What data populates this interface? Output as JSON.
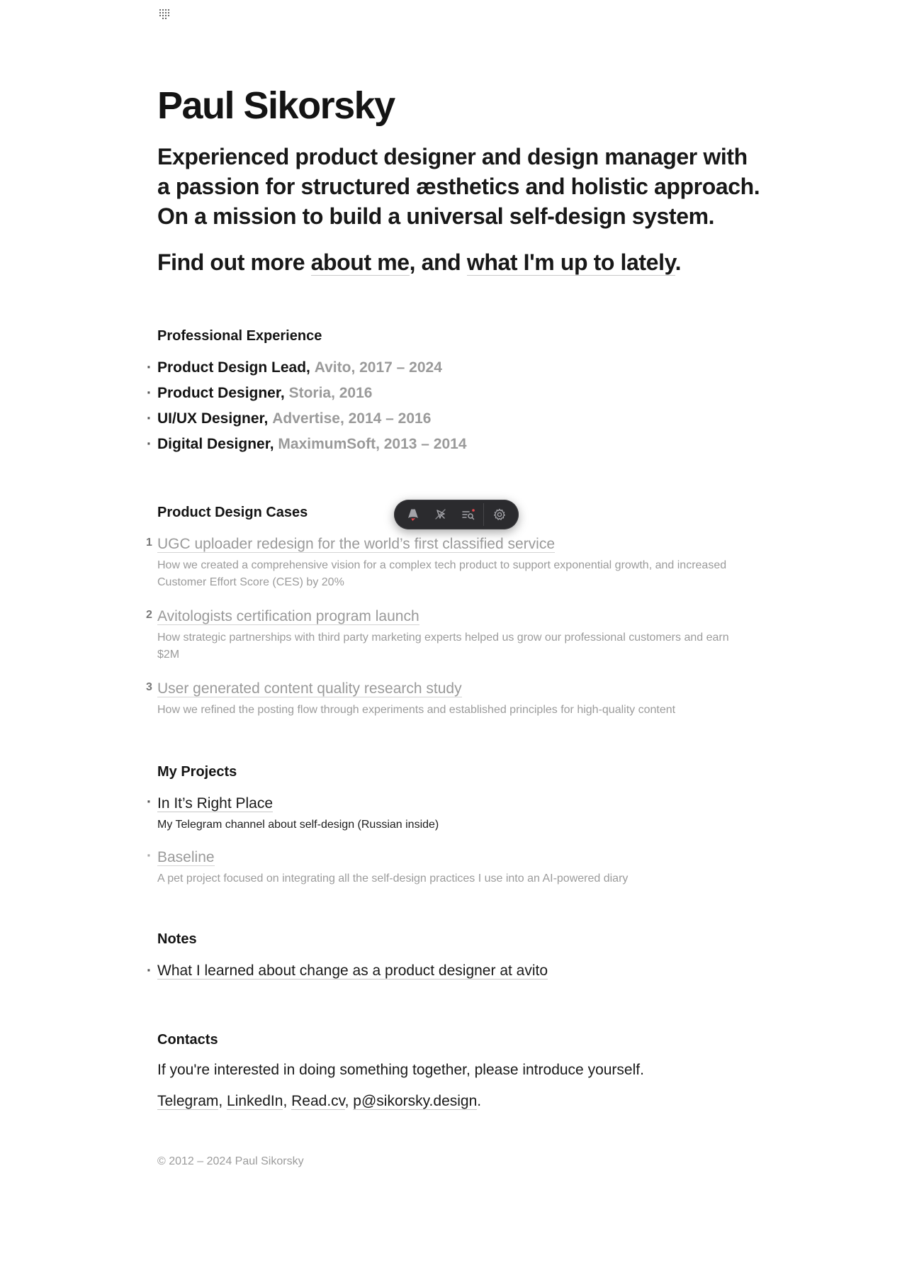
{
  "profile": {
    "name": "Paul Sikorsky",
    "tagline_lines": [
      "Experienced product designer and design manager with",
      "a passion for structured æsthetics and holistic approach.",
      "On a mission to build a universal self-design system."
    ],
    "find_more": {
      "prefix": "Find out more ",
      "about_link": "about me",
      "middle": ", and ",
      "lately_link": "what I'm up to lately",
      "suffix": "."
    }
  },
  "experience": {
    "title": "Professional Experience",
    "items": [
      {
        "role": "Product Design Lead,",
        "meta": "Avito, 2017 – 2024"
      },
      {
        "role": "Product Designer,",
        "meta": "Storia, 2016"
      },
      {
        "role": "UI/UX Designer,",
        "meta": "Advertise, 2014 – 2016"
      },
      {
        "role": "Digital Designer,",
        "meta": "MaximumSoft, 2013 – 2014"
      }
    ]
  },
  "cases": {
    "title": "Product Design Cases",
    "items": [
      {
        "num": "1",
        "title": "UGC uploader redesign for the world’s first classified service",
        "desc": "How we created a comprehensive vision for a complex tech product to support exponential growth, and increased Customer Effort Score (CES) by 20%"
      },
      {
        "num": "2",
        "title": "Avitologists certification program launch",
        "desc": "How strategic partnerships with third party marketing experts helped us grow our professional customers and earn $2M"
      },
      {
        "num": "3",
        "title": "User generated content quality research study",
        "desc": "How we refined the posting flow through experiments and established principles for high-quality content"
      }
    ]
  },
  "projects": {
    "title": "My Projects",
    "items": [
      {
        "title": "In It’s Right Place",
        "desc": "My Telegram channel about self-design (Russian inside)"
      },
      {
        "title": "Baseline",
        "desc": "A pet project focused on integrating all the self-design practices I use into an AI-powered diary"
      }
    ]
  },
  "notes": {
    "title": "Notes",
    "items": [
      {
        "title": "What I learned about change as a product designer at avito"
      }
    ]
  },
  "contacts": {
    "title": "Contacts",
    "intro": "If you're interested in doing something together, please introduce yourself.",
    "links": [
      "Telegram",
      "LinkedIn",
      "Read.cv",
      "p@sikorsky.design"
    ],
    "separator": ", ",
    "end": "."
  },
  "footer": {
    "copyright": "© 2012 – 2024 Paul Sikorsky"
  },
  "toolbar": {
    "icons": [
      "astro-logo-icon",
      "cursor-inspect-icon",
      "audit-list-icon",
      "gear-icon"
    ],
    "accent": "#e5484d"
  },
  "bullet_char": "·"
}
